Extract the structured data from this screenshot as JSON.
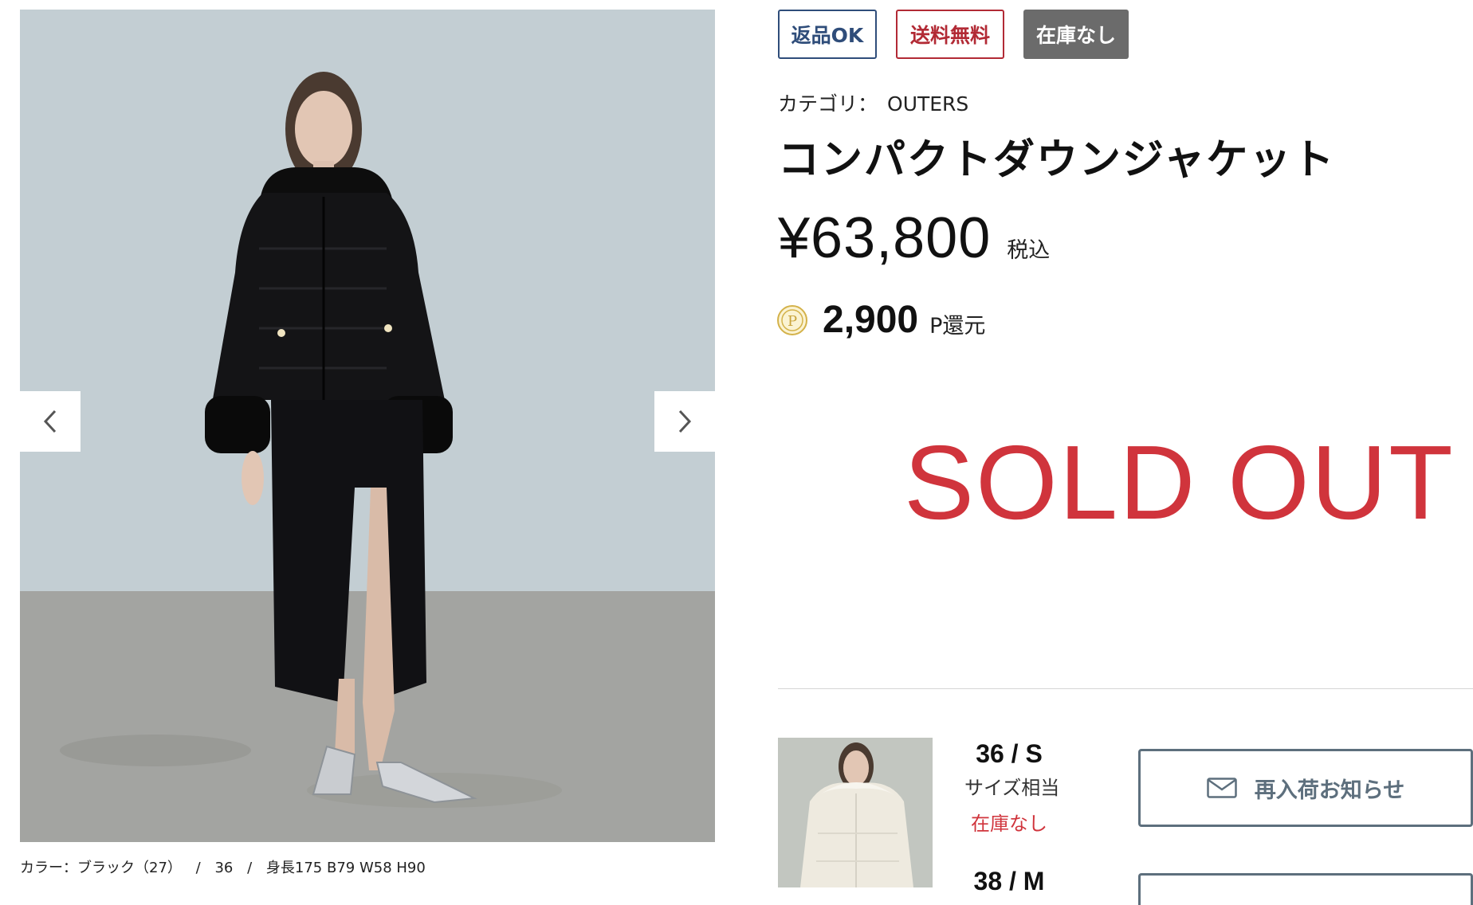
{
  "gallery": {
    "image_alt": "",
    "prev_icon": "chevron-left-icon",
    "next_icon": "chevron-right-icon",
    "caption": {
      "color": "カラー：ブラック（27）",
      "size": "36",
      "model": "身長175 B79 W58 H90",
      "separator": "/"
    }
  },
  "badges": {
    "return": "返品OK",
    "shipping": "送料無料",
    "stock": "在庫なし",
    "colors": {
      "return": "#2f4d7a",
      "shipping": "#b22a35",
      "stock": "#6b6b6b"
    }
  },
  "product": {
    "category_label": "カテゴリ：",
    "category_value": "OUTERS",
    "title": "コンパクトダウンジャケット",
    "price": "¥63,800",
    "tax_note": "税込",
    "points_value": "2,900",
    "points_unit": "P還元",
    "points_icon": "point-coin-icon",
    "status": "SOLD OUT",
    "status_color": "#d0343c"
  },
  "variants": [
    {
      "size": "36 / S",
      "note": "サイズ相当",
      "stock": "在庫なし",
      "button_label": "再入荷お知らせ",
      "button_icon": "mail-icon"
    },
    {
      "size": "38 / M"
    }
  ]
}
